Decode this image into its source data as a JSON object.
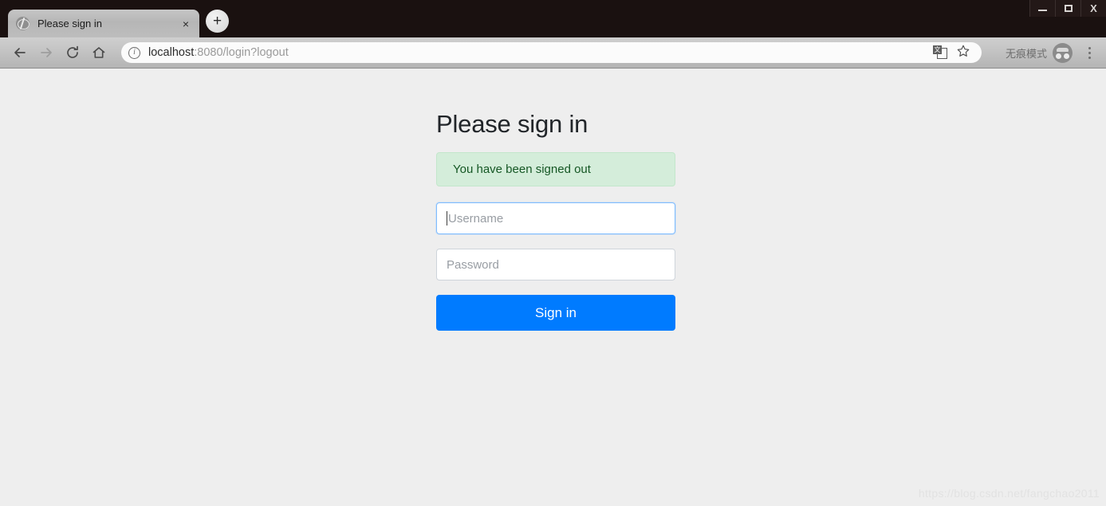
{
  "window": {
    "controls": {
      "minimize_label": "Minimize",
      "maximize_label": "Maximize",
      "close_label": "X"
    }
  },
  "tabstrip": {
    "tab": {
      "title": "Please sign in",
      "favicon": "globe-icon",
      "close_label": "×"
    },
    "new_tab_label": "+"
  },
  "toolbar": {
    "back_icon": "back-arrow-icon",
    "forward_icon": "forward-arrow-icon",
    "reload_icon": "reload-icon",
    "home_icon": "home-icon",
    "omnibox": {
      "security_icon": "info-circle-icon",
      "url_host": "localhost",
      "url_rest": ":8080/login?logout",
      "full_url": "localhost:8080/login?logout",
      "translate_icon": "translate-icon",
      "translate_glyph": "文",
      "bookmark_icon": "star-icon"
    },
    "incognito_label": "无痕模式",
    "incognito_icon": "incognito-icon",
    "menu_icon": "three-dot-menu-icon"
  },
  "page": {
    "heading": "Please sign in",
    "alert": {
      "message": "You have been signed out",
      "background": "#d4edda",
      "border": "#c3e6cb",
      "text_color": "#155724"
    },
    "username": {
      "placeholder": "Username",
      "value": "",
      "focused": true
    },
    "password": {
      "placeholder": "Password",
      "value": "",
      "focused": false
    },
    "submit_label": "Sign in",
    "accent_color": "#007bff",
    "background_color": "#eeeeee",
    "watermark": "https://blog.csdn.net/fangchao2011"
  }
}
